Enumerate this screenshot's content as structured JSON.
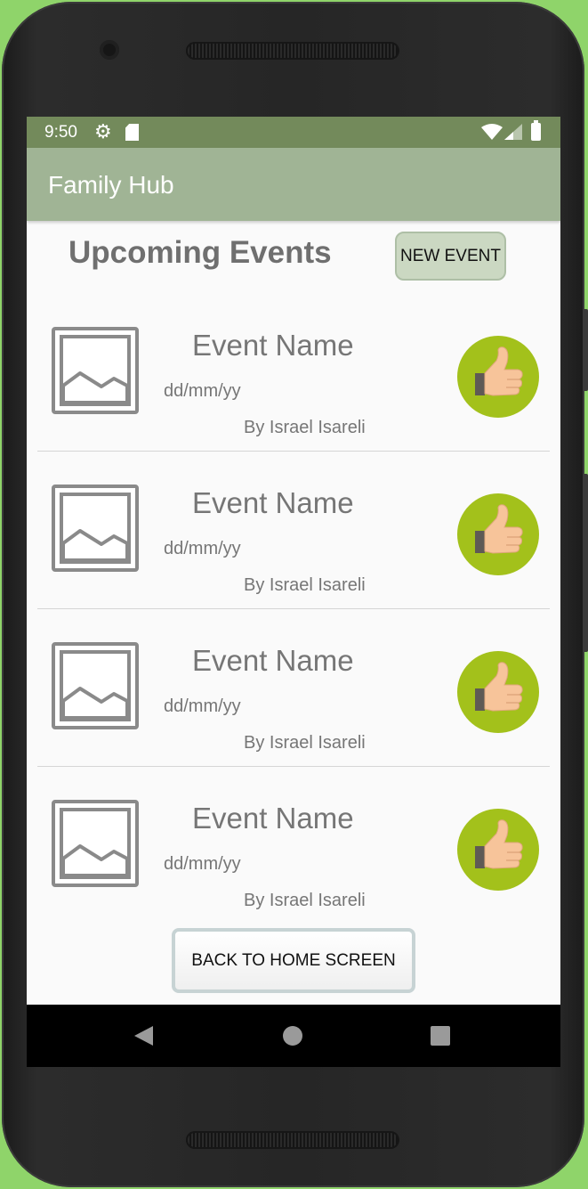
{
  "status_bar": {
    "time": "9:50",
    "icons": [
      "gear-icon",
      "sd-card-icon",
      "wifi-icon",
      "signal-icon",
      "battery-icon"
    ]
  },
  "app_bar": {
    "title": "Family Hub"
  },
  "header": {
    "heading": "Upcoming Events",
    "new_event_label": "NEW EVENT"
  },
  "events": [
    {
      "name": "Event Name",
      "date": "dd/mm/yy",
      "author": "By Israel Isareli"
    },
    {
      "name": "Event Name",
      "date": "dd/mm/yy",
      "author": "By Israel Isareli"
    },
    {
      "name": "Event Name",
      "date": "dd/mm/yy",
      "author": "By Israel Isareli"
    },
    {
      "name": "Event Name",
      "date": "dd/mm/yy",
      "author": "By Israel Isareli"
    }
  ],
  "footer": {
    "back_label": "BACK TO HOME SCREEN"
  },
  "nav": {
    "icons": [
      "back-icon",
      "home-icon",
      "recents-icon"
    ]
  },
  "colors": {
    "background": "#8fd46a",
    "status_bar": "#738a5b",
    "app_bar": "#a0b495",
    "new_event_button": "#cbd8c2",
    "like_button": "#a3c11b",
    "text_gray": "#767676"
  }
}
